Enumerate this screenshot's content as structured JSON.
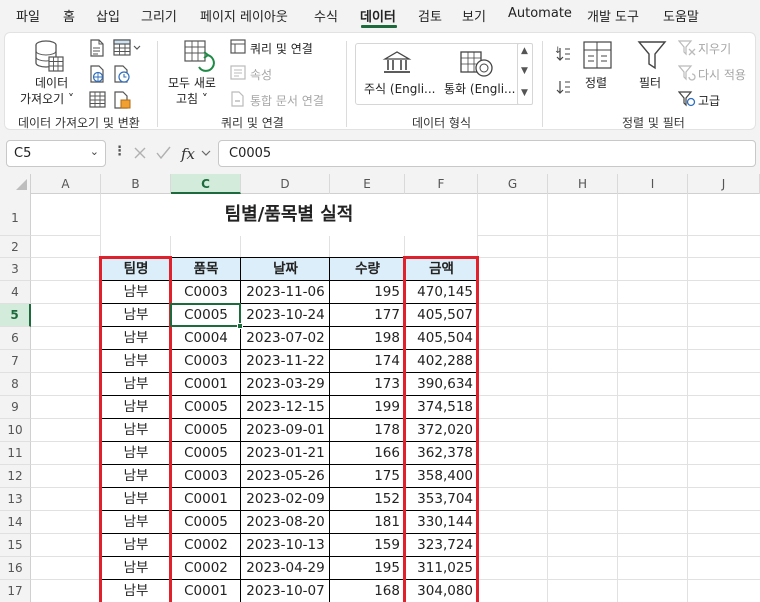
{
  "menu": {
    "items": [
      "파일",
      "홈",
      "삽입",
      "그리기",
      "페이지 레이아웃",
      "수식",
      "데이터",
      "검토",
      "보기",
      "Automate",
      "개발 도구",
      "도움말"
    ],
    "active": "데이터"
  },
  "ribbon": {
    "get_data": {
      "line1": "데이터",
      "line2": "가져오기 ˅"
    },
    "group1_label": "데이터 가져오기 및 변환",
    "refresh": {
      "line1": "모두 새로",
      "line2": "고침 ˅"
    },
    "queries_connections": "쿼리 및 연결",
    "properties": "속성",
    "edit_links": "통합 문서 연결",
    "group2_label": "쿼리 및 연결",
    "stocks": "주식 (Engli...",
    "currency": "통화 (Engli...",
    "group3_label": "데이터 형식",
    "sort": "정렬",
    "filter": "필터",
    "clear": "지우기",
    "reapply": "다시 적용",
    "advanced": "고급",
    "group4_label": "정렬 및 필터",
    "sort_asc_icon": "az-sort-icon",
    "sort_desc_icon": "za-sort-icon"
  },
  "formula_bar": {
    "name_box": "C5",
    "fx": "fx",
    "formula": "C0005"
  },
  "grid": {
    "columns": [
      "A",
      "B",
      "C",
      "D",
      "E",
      "F",
      "G",
      "H",
      "I",
      "J"
    ],
    "rows": [
      "1",
      "2",
      "3",
      "4",
      "5",
      "6",
      "7",
      "8",
      "9",
      "10",
      "11",
      "12",
      "13",
      "14",
      "15",
      "16",
      "17"
    ],
    "selected_column": "C",
    "selected_row": "5",
    "title": "팀별/품목별 실적",
    "headers": [
      "팀명",
      "품목",
      "날짜",
      "수량",
      "금액"
    ],
    "data": [
      [
        "남부",
        "C0003",
        "2023-11-06",
        "195",
        "470,145"
      ],
      [
        "남부",
        "C0005",
        "2023-10-24",
        "177",
        "405,507"
      ],
      [
        "남부",
        "C0004",
        "2023-07-02",
        "198",
        "405,504"
      ],
      [
        "남부",
        "C0003",
        "2023-11-22",
        "174",
        "402,288"
      ],
      [
        "남부",
        "C0001",
        "2023-03-29",
        "173",
        "390,634"
      ],
      [
        "남부",
        "C0005",
        "2023-12-15",
        "199",
        "374,518"
      ],
      [
        "남부",
        "C0005",
        "2023-09-01",
        "178",
        "372,020"
      ],
      [
        "남부",
        "C0005",
        "2023-01-21",
        "166",
        "362,378"
      ],
      [
        "남부",
        "C0003",
        "2023-05-26",
        "175",
        "358,400"
      ],
      [
        "남부",
        "C0001",
        "2023-02-09",
        "152",
        "353,704"
      ],
      [
        "남부",
        "C0005",
        "2023-08-20",
        "181",
        "330,144"
      ],
      [
        "남부",
        "C0002",
        "2023-10-13",
        "159",
        "323,724"
      ],
      [
        "남부",
        "C0002",
        "2023-04-29",
        "195",
        "311,025"
      ],
      [
        "남부",
        "C0001",
        "2023-10-07",
        "168",
        "304,080"
      ]
    ],
    "colors": {
      "header_fill": "#dceef9",
      "highlight_border": "#e0202a",
      "selection": "#1d6b3c"
    }
  }
}
